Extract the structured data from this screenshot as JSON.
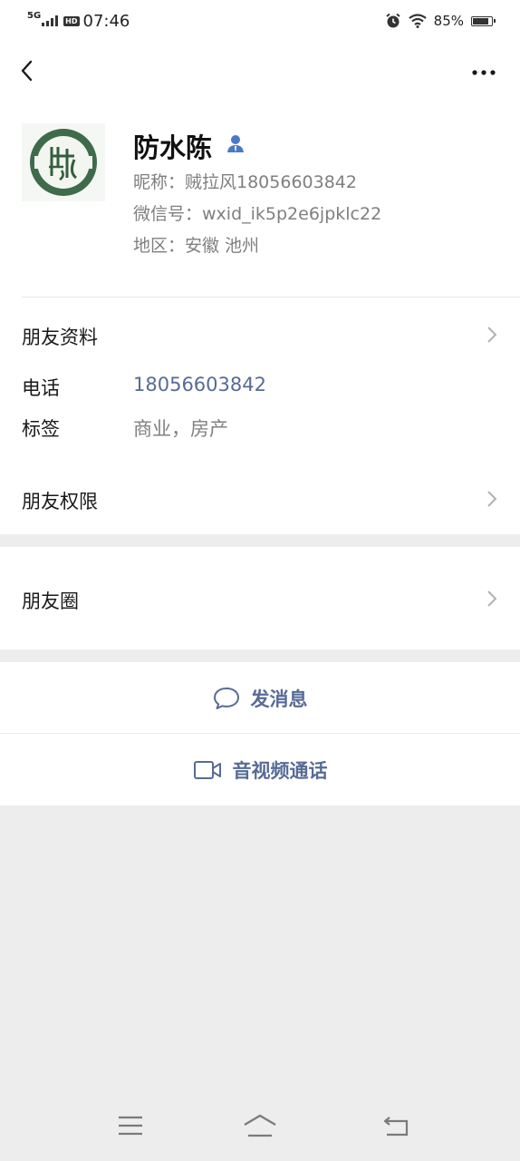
{
  "status_bar": {
    "network": "5G",
    "hd": "HD",
    "time": "07:46",
    "battery": "85%",
    "battery_level": 0.85
  },
  "header": {
    "back_icon": "chevron-left-icon",
    "more_icon": "more-dots-icon"
  },
  "profile": {
    "name": "防水陈",
    "nickname": "昵称：贼拉风18056603842",
    "wechat_id": "微信号：wxid_ik5p2e6jpklc22",
    "region": "地区：安徽  池州",
    "accent_color": "#576b95"
  },
  "friend_info": {
    "title": "朋友资料",
    "phone_label": "电话",
    "phone_value": "18056603842",
    "tags_label": "标签",
    "tags_value": "商业，房产"
  },
  "permissions": {
    "title": "朋友权限"
  },
  "moments": {
    "title": "朋友圈"
  },
  "actions": {
    "message": "发消息",
    "video_call": "音视频通话"
  },
  "bottom_nav": {
    "menu_icon": "menu-icon",
    "home_icon": "home-icon",
    "back_icon": "back-icon"
  }
}
